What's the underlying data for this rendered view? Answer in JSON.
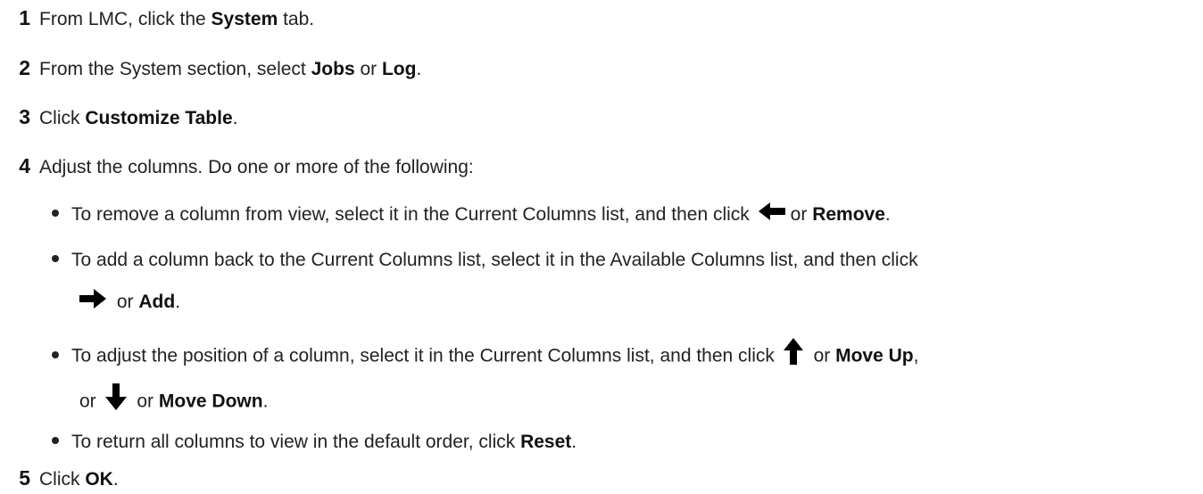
{
  "steps": [
    {
      "num": "1",
      "parts": [
        "From LMC, click the ",
        "System",
        " tab."
      ]
    },
    {
      "num": "2",
      "parts": [
        "From the System section, select ",
        "Jobs",
        " or ",
        "Log",
        "."
      ]
    },
    {
      "num": "3",
      "parts": [
        "Click ",
        "Customize Table",
        "."
      ]
    },
    {
      "num": "4",
      "text": "Adjust the columns. Do one or more of the following:"
    },
    {
      "num": "5",
      "parts": [
        "Click ",
        "OK",
        "."
      ]
    }
  ],
  "bullets": {
    "remove": {
      "text": "To remove a column from view, select it in the Current Columns list, and then click",
      "or": "or",
      "bold": "Remove",
      "end": "."
    },
    "add": {
      "text": "To add a column back to the Current Columns list, select it in the Available Columns list, and then click",
      "or": "or",
      "bold": "Add",
      "end": "."
    },
    "move": {
      "text": "To adjust the position of a column, select it in the Current Columns list, and then click",
      "or": "or",
      "bold": "Move Up",
      "end": ",",
      "or2": "or",
      "or3": "or",
      "bold2": "Move Down",
      "end2": "."
    },
    "reset": {
      "text": "To return all columns to view in the default order, click ",
      "bold": "Reset",
      "end": "."
    }
  },
  "icons": [
    "arrow-left-icon",
    "arrow-right-icon",
    "arrow-up-icon",
    "arrow-down-icon"
  ]
}
